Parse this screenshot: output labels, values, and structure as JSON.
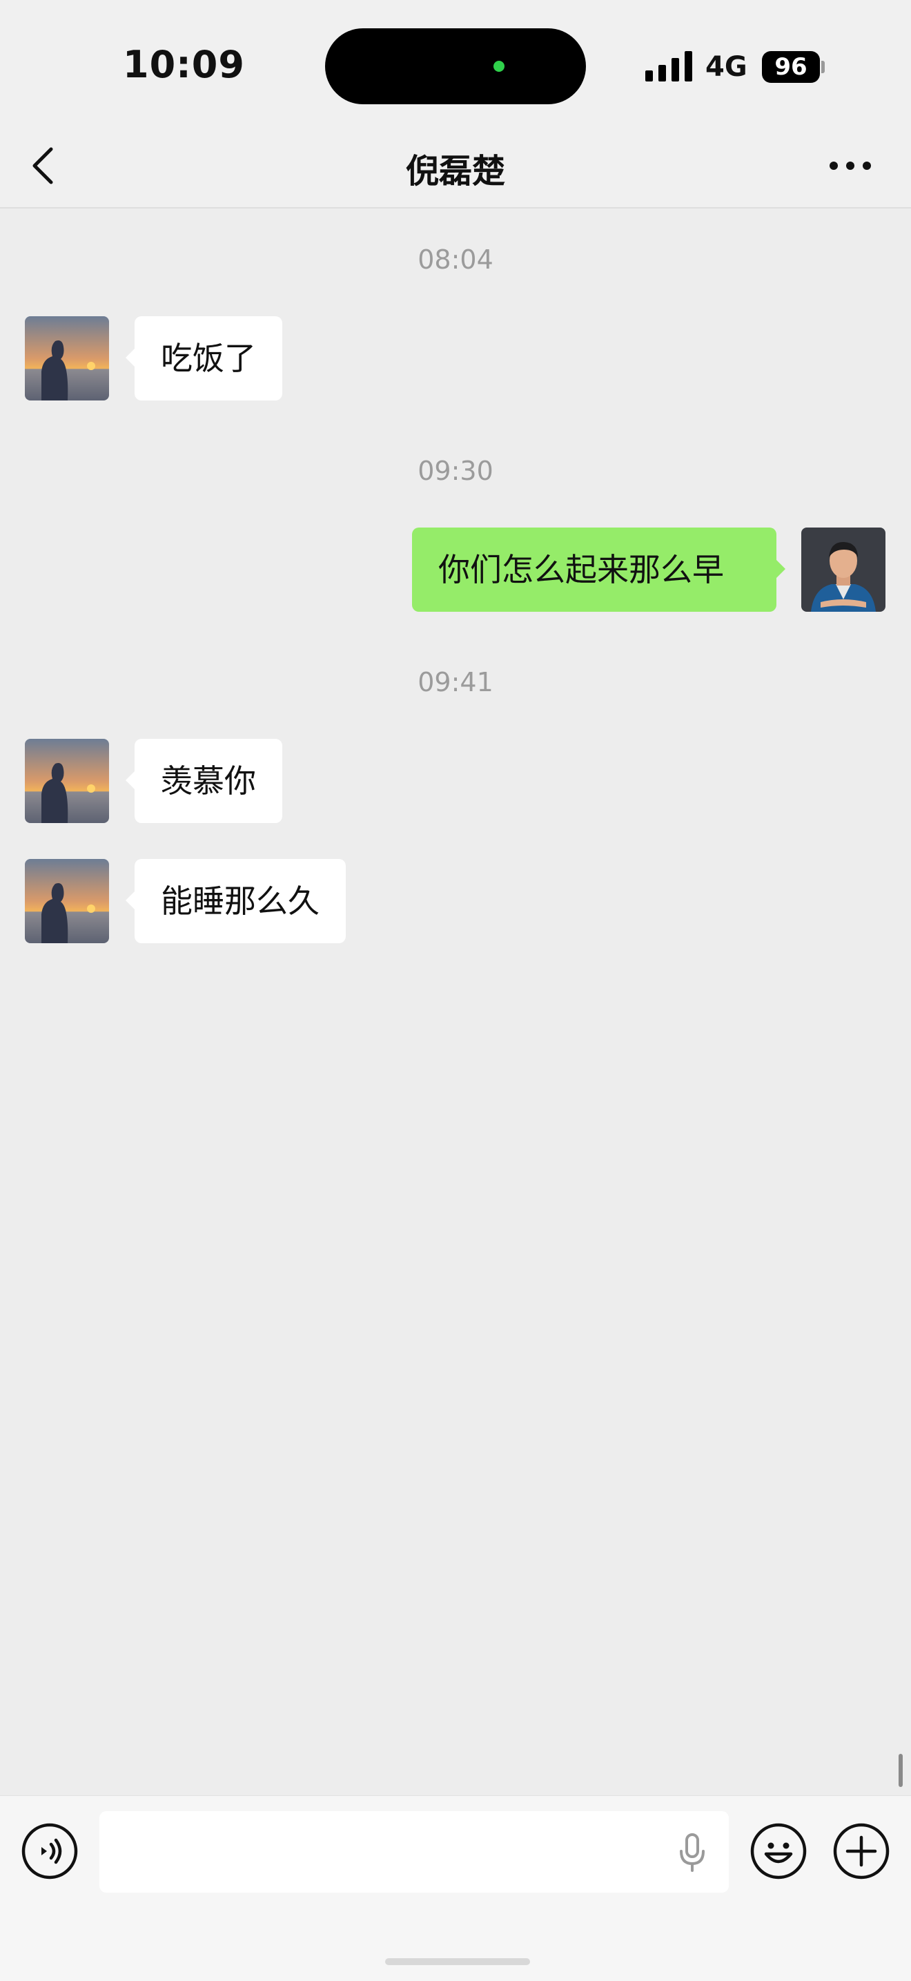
{
  "status_bar": {
    "time": "10:09",
    "network": "4G",
    "battery": "96"
  },
  "nav": {
    "title": "倪磊楚"
  },
  "messages": [
    {
      "timestamp": "08:04",
      "side": "left",
      "text": "吃饭了"
    },
    {
      "timestamp": "09:30",
      "side": "right",
      "text": "你们怎么起来那么早"
    },
    {
      "timestamp": "09:41",
      "side": "left",
      "text": "羡慕你"
    },
    {
      "side": "left",
      "text": "能睡那么久"
    }
  ],
  "input": {
    "value": "",
    "placeholder": ""
  },
  "icons": {
    "back": "chevron-left-icon",
    "more": "more-dots-icon",
    "voice": "voice-icon",
    "mic": "mic-icon",
    "emoji": "emoji-icon",
    "plus": "plus-icon"
  },
  "colors": {
    "background": "#ededed",
    "sent_bubble": "#95ec69",
    "received_bubble": "#ffffff",
    "timestamp": "#9b9b9b"
  }
}
